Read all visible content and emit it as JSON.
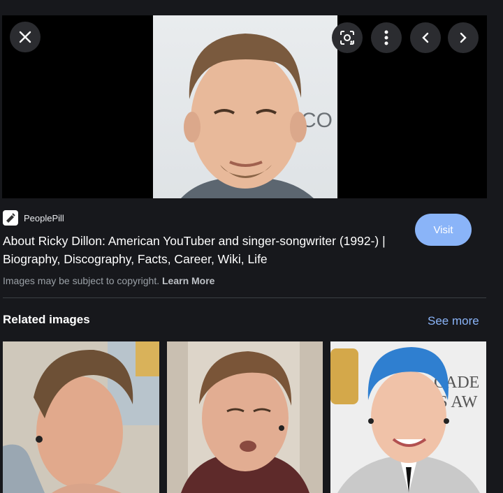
{
  "viewer": {
    "close_icon": "close-icon",
    "lens_icon": "lens-icon",
    "more_icon": "more-vert-icon",
    "prev_icon": "chevron-left-icon",
    "next_icon": "chevron-right-icon"
  },
  "source": {
    "name": "PeoplePill",
    "title": "About Ricky Dillon: American YouTuber and singer-songwriter (1992-) | Biography, Discography, Facts, Career, Wiki, Life",
    "copyright_text": "Images may be subject to copyright.",
    "learn_more": "Learn More",
    "visit_label": "Visit"
  },
  "related": {
    "heading": "Related images",
    "see_more": "See more"
  },
  "colors": {
    "background": "#17181c",
    "accent": "#8ab4f8",
    "button_bg": "#2b2c30"
  }
}
